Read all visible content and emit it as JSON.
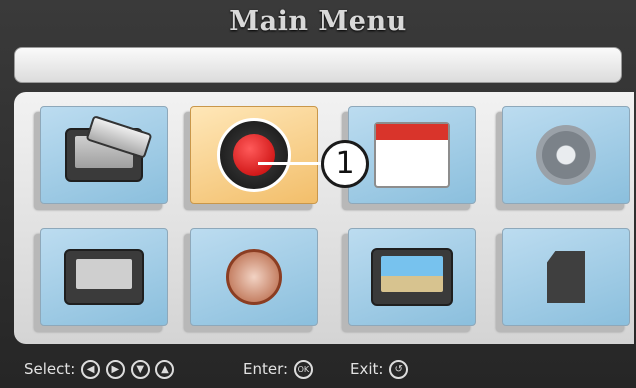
{
  "title": "Main Menu",
  "info_bar_text": "",
  "menu_items": [
    {
      "name": "camera-view",
      "icon": "monitor-camera-icon",
      "selected": false
    },
    {
      "name": "record",
      "icon": "record-icon",
      "selected": true
    },
    {
      "name": "calendar",
      "icon": "calendar-icon",
      "selected": false
    },
    {
      "name": "settings",
      "icon": "gear-icon",
      "selected": false
    },
    {
      "name": "monitor",
      "icon": "monitor-icon",
      "selected": false
    },
    {
      "name": "alarm-clock",
      "icon": "clock-icon",
      "selected": false
    },
    {
      "name": "playback-search",
      "icon": "image-search-icon",
      "selected": false
    },
    {
      "name": "sd-card",
      "icon": "sd-card-icon",
      "selected": false
    }
  ],
  "callout_number": "1",
  "footer": {
    "select_label": "Select:",
    "enter_label": "Enter:",
    "exit_label": "Exit:",
    "enter_button": "OK"
  }
}
